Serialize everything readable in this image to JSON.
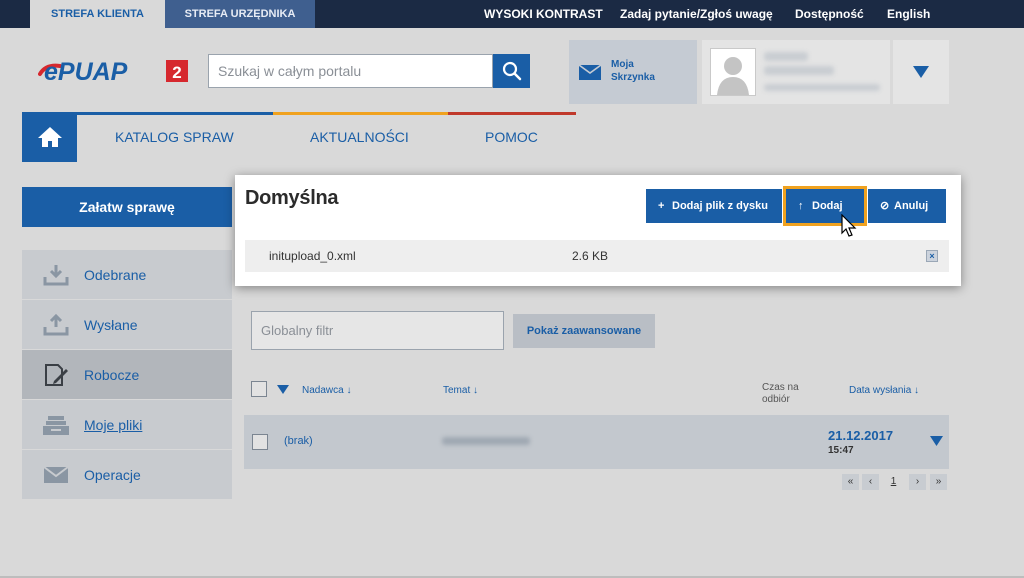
{
  "topbar": {
    "tab_client": "STREFA KLIENTA",
    "tab_official": "STREFA URZĘDNIKA",
    "links": [
      "WYSOKI KONTRAST",
      "Zadaj pytanie/Zgłoś uwagę",
      "Dostępność",
      "English"
    ]
  },
  "header": {
    "logo_text": "ePUAP",
    "logo_version": "2",
    "search_placeholder": "Szukaj w całym portalu",
    "mailbox_label_line1": "Moja",
    "mailbox_label_line2": "Skrzynka"
  },
  "nav": {
    "items": [
      "KATALOG SPRAW",
      "AKTUALNOŚCI",
      "POMOC"
    ],
    "colors": [
      "#1a5ea6",
      "#f0a21f",
      "#c0392b"
    ]
  },
  "sidebar": {
    "cta": "Załatw sprawę",
    "items": [
      {
        "label": "Odebrane",
        "icon": "inbox-download-icon"
      },
      {
        "label": "Wysłane",
        "icon": "outbox-upload-icon"
      },
      {
        "label": "Robocze",
        "icon": "draft-edit-icon"
      },
      {
        "label": "Moje pliki",
        "icon": "files-tray-icon"
      },
      {
        "label": "Operacje",
        "icon": "envelope-icon"
      }
    ]
  },
  "filter": {
    "placeholder": "Globalny filtr",
    "advanced_button": "Pokaż zaawansowane"
  },
  "table": {
    "headers": {
      "sender": "Nadawca ↓",
      "subject": "Temat ↓",
      "reply_time_line1": "Czas na",
      "reply_time_line2": "odbiór",
      "sent_date": "Data wysłania ↓"
    },
    "rows": [
      {
        "sender": "(brak)",
        "date": "21.12.2017",
        "time": "15:47"
      }
    ],
    "pager": [
      "«",
      "‹",
      "1",
      "›",
      "»"
    ]
  },
  "modal": {
    "title": "Domyślna",
    "add_file_button": "Dodaj plik z dysku",
    "add_button": "Dodaj",
    "cancel_button": "Anuluj",
    "file": {
      "name": "initupload_0.xml",
      "size": "2.6 KB"
    },
    "remove_glyph": "×"
  },
  "colors": {
    "brand_blue": "#1a5ea6",
    "focus_orange": "#f0a21f",
    "topbar": "#1b2a44"
  }
}
